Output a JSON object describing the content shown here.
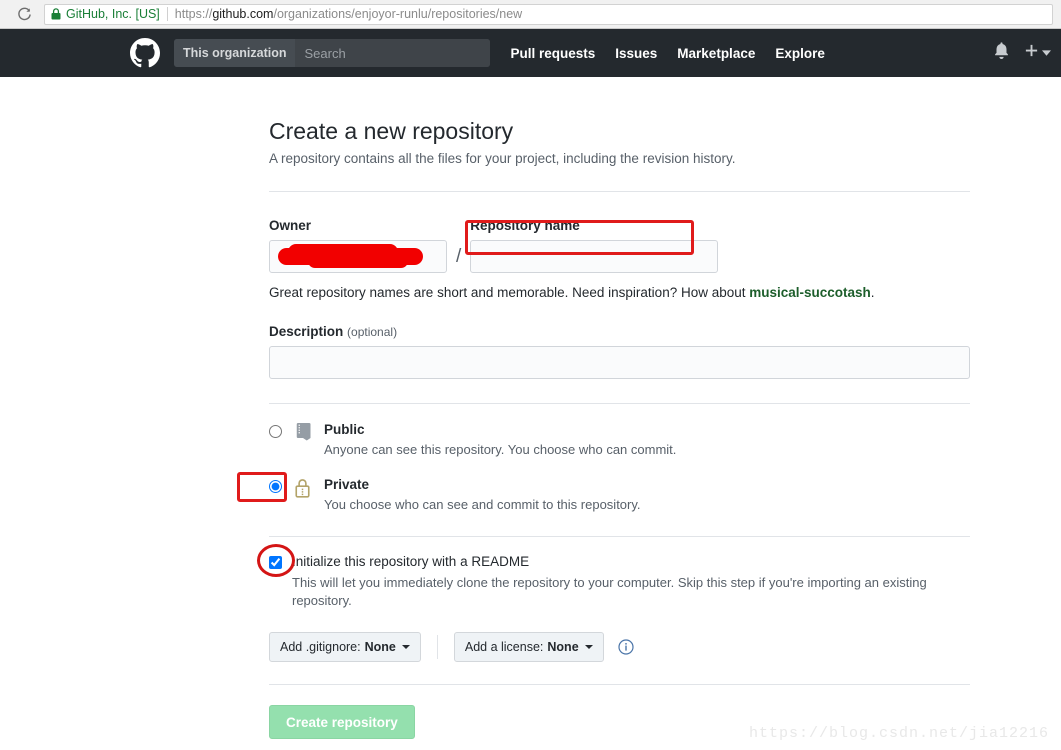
{
  "browser": {
    "reload_icon": "reload-icon",
    "lock_icon": "lock-icon",
    "security_label": "GitHub, Inc. [US]",
    "url_scheme": "https://",
    "url_domain": "github.com",
    "url_path": "/organizations/enjoyor-runlu/repositories/new"
  },
  "header": {
    "logo_icon": "github-logo-icon",
    "search_scope": "This organization",
    "search_placeholder": "Search",
    "search_value": "",
    "nav": [
      {
        "label": "Pull requests"
      },
      {
        "label": "Issues"
      },
      {
        "label": "Marketplace"
      },
      {
        "label": "Explore"
      }
    ],
    "notifications_icon": "bell-icon",
    "plus_icon": "plus-icon",
    "plus_caret_icon": "chevron-down-icon"
  },
  "main": {
    "title": "Create a new repository",
    "subtitle": "A repository contains all the files for your project, including the revision history.",
    "owner": {
      "label": "Owner",
      "value": "",
      "redacted": true
    },
    "separator": "/",
    "repo_name": {
      "label": "Repository name",
      "value": "",
      "placeholder": ""
    },
    "repo_hint": {
      "prefix": "Great repository names are short and memorable. Need inspiration? How about ",
      "suggestion": "musical-succotash",
      "suffix": "."
    },
    "description": {
      "label": "Description",
      "optional": "(optional)",
      "value": "",
      "placeholder": ""
    },
    "visibility": {
      "public": {
        "title": "Public",
        "desc": "Anyone can see this repository. You choose who can commit.",
        "icon": "repo-book-icon",
        "selected": false
      },
      "private": {
        "title": "Private",
        "desc": "You choose who can see and commit to this repository.",
        "icon": "lock-icon",
        "selected": true
      }
    },
    "readme": {
      "title": "Initialize this repository with a README",
      "desc": "This will let you immediately clone the repository to your computer. Skip this step if you're importing an existing repository.",
      "checked": true
    },
    "gitignore": {
      "label": "Add .gitignore:",
      "value": "None"
    },
    "license": {
      "label": "Add a license:",
      "value": "None",
      "info_icon": "info-icon"
    },
    "submit_label": "Create repository"
  },
  "watermark": "https://blog.csdn.net/jia12216",
  "colors": {
    "header_bg": "#24292e",
    "annotation_red": "#e01b1b",
    "suggestion_green": "#1d5e2b",
    "submit_green": "#94e0ae",
    "selected_blue": "#1f7ce0"
  }
}
